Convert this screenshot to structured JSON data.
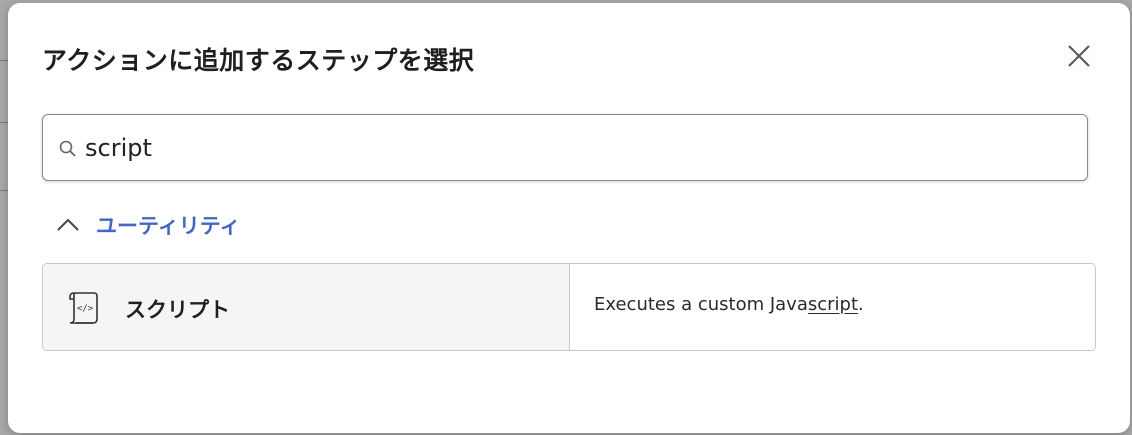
{
  "dialog": {
    "title": "アクションに追加するステップを選択",
    "close_icon": "close-icon"
  },
  "search": {
    "value": "script",
    "placeholder": "",
    "icon": "search-icon"
  },
  "category": {
    "label": "ユーティリティ",
    "expanded": true,
    "icon": "chevron-up-icon",
    "color": "#3f64d8"
  },
  "results": [
    {
      "name": "スクリプト",
      "icon": "script-icon",
      "description_prefix": "Executes a custom Java",
      "description_match": "script",
      "description_suffix": "."
    }
  ]
}
